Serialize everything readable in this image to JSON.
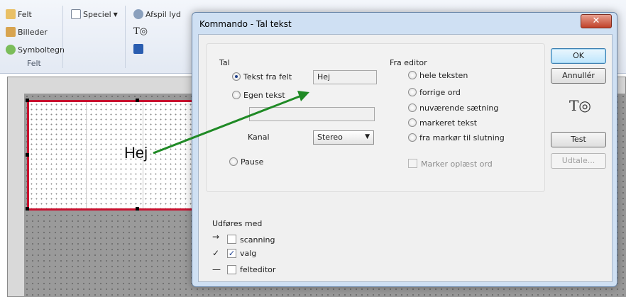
{
  "ribbon": {
    "felt": "Felt",
    "billeder": "Billeder",
    "symboltegn": "Symboltegn",
    "group_label": "Felt",
    "speciel": "Speciel",
    "afspil_lyd": "Afspil lyd"
  },
  "editor": {
    "cell_text": "Hej"
  },
  "dialog": {
    "title": "Kommando - Tal tekst",
    "close": "✕",
    "tal": {
      "section_label": "Tal",
      "tekst_fra_felt": "Tekst fra felt",
      "tekst_fra_felt_value": "Hej",
      "egen_tekst": "Egen tekst",
      "egen_tekst_value": "",
      "kanal_label": "Kanal",
      "kanal_value": "Stereo",
      "pause": "Pause"
    },
    "fra_editor": {
      "section_label": "Fra editor",
      "options": [
        "hele teksten",
        "forrige ord",
        "nuværende sætning",
        "markeret tekst",
        "fra markør til slutning"
      ],
      "marker_oplaest_ord": "Marker oplæst ord"
    },
    "udfores_med": {
      "section_label": "Udføres med",
      "options": [
        {
          "mark": "→",
          "label": "scanning",
          "checked": false
        },
        {
          "mark": "✓",
          "label": "valg",
          "checked": true
        },
        {
          "mark": "—",
          "label": "felteditor",
          "checked": false
        }
      ]
    },
    "buttons": {
      "ok": "OK",
      "annuller": "Annullér",
      "test": "Test",
      "udtale": "Udtale..."
    },
    "icon_text": "T◎"
  },
  "colors": {
    "page_border": "#c8102e",
    "arrow": "#1f8a25",
    "dialog_frame": "#cfe0f3",
    "close_button": "#c0412a"
  }
}
